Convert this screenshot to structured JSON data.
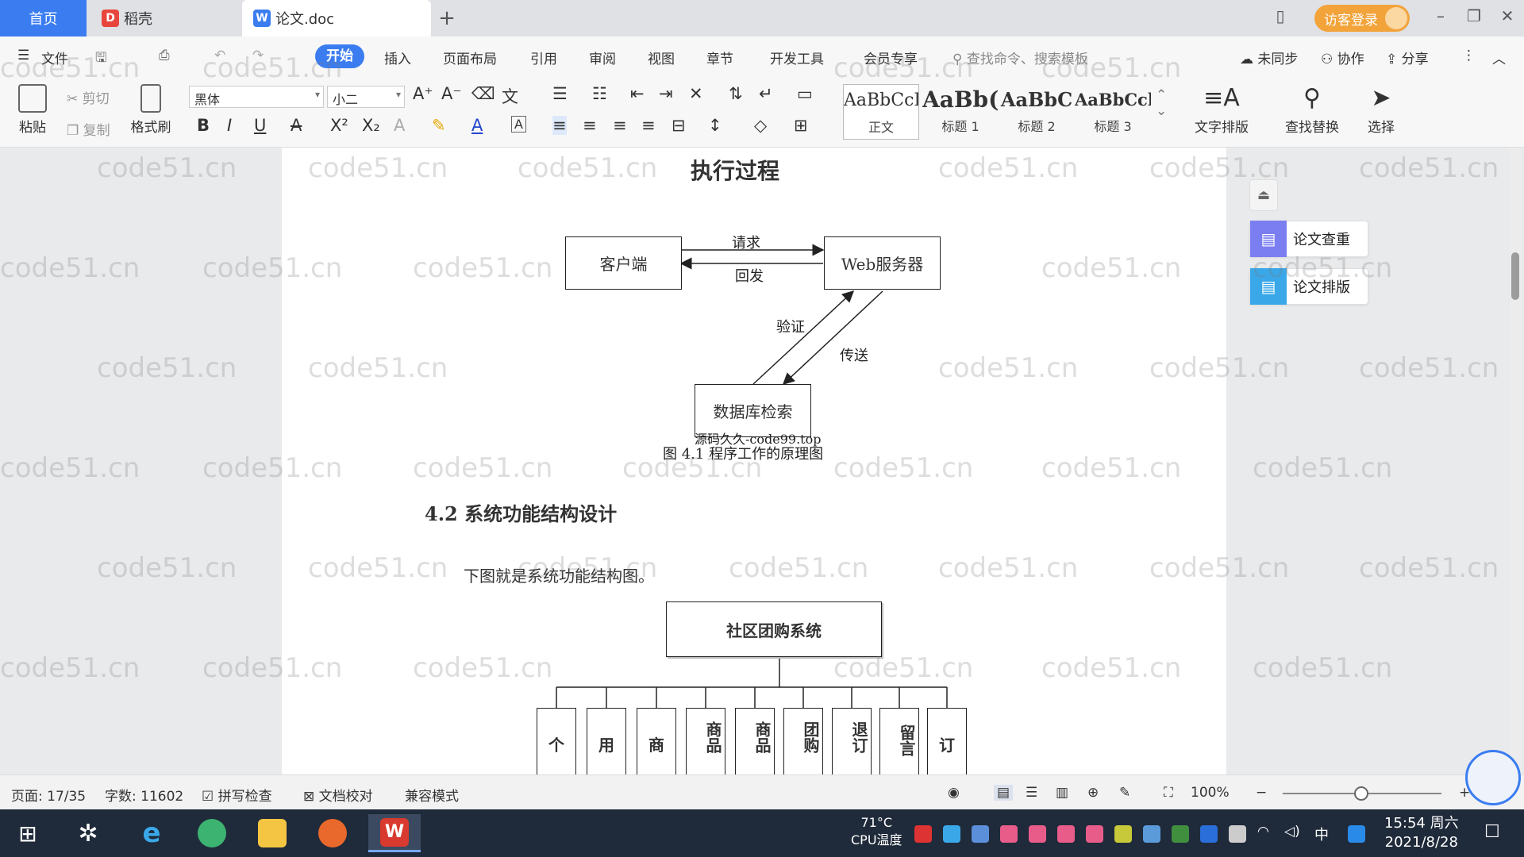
{
  "titlebar": {
    "tabs": [
      {
        "label": "首页"
      },
      {
        "label": "稻壳"
      },
      {
        "label": "论文.doc"
      }
    ],
    "add_tab": "+",
    "login": "访客登录"
  },
  "menubar": {
    "file": "文件",
    "items": [
      "开始",
      "插入",
      "页面布局",
      "引用",
      "审阅",
      "视图",
      "章节",
      "开发工具",
      "会员专享"
    ],
    "search_placeholder": "查找命令、搜索模板",
    "sync": "未同步",
    "collab": "协作",
    "share": "分享"
  },
  "ribbon": {
    "paste": "粘贴",
    "cut": "剪切",
    "copy": "复制",
    "format_painter": "格式刷",
    "font_family": "黑体",
    "font_size": "小二",
    "styles": [
      {
        "sample": "AaBbCcI",
        "label": "正文"
      },
      {
        "sample": "AaBb(",
        "label": "标题 1"
      },
      {
        "sample": "AaBbC",
        "label": "标题 2"
      },
      {
        "sample": "AaBbCcl",
        "label": "标题 3"
      }
    ],
    "text_layout": "文字排版",
    "find_replace": "查找替换",
    "select": "选择"
  },
  "document": {
    "heading_top": "执行过程",
    "diagram1": {
      "client": "客户端",
      "server": "Web服务器",
      "db": "数据库检索",
      "request": "请求",
      "reply": "回发",
      "verify": "验证",
      "transmit": "传送",
      "watermark_text": "源码久久-code99.top",
      "caption": "图 4.1  程序工作的原理图"
    },
    "section_title": "4.2 系统功能结构设计",
    "paragraph": "下图就是系统功能结构图。",
    "diagram2": {
      "root": "社区团购系统",
      "children": [
        "个",
        "用",
        "商",
        "商品",
        "商品",
        "团购",
        "退订",
        "留言",
        "订"
      ]
    }
  },
  "side_panel": {
    "check": "论文查重",
    "layout": "论文排版"
  },
  "watermark": "code51.cn",
  "statusbar": {
    "page": "页面: 17/35",
    "words": "字数: 11602",
    "spell": "拼写检查",
    "proof": "文档校对",
    "compat": "兼容模式",
    "zoom": "100%"
  },
  "taskbar": {
    "cpu_temp": "71°C",
    "cpu_label": "CPU温度",
    "ime": "中",
    "time": "15:54 周六",
    "date": "2021/8/28"
  }
}
